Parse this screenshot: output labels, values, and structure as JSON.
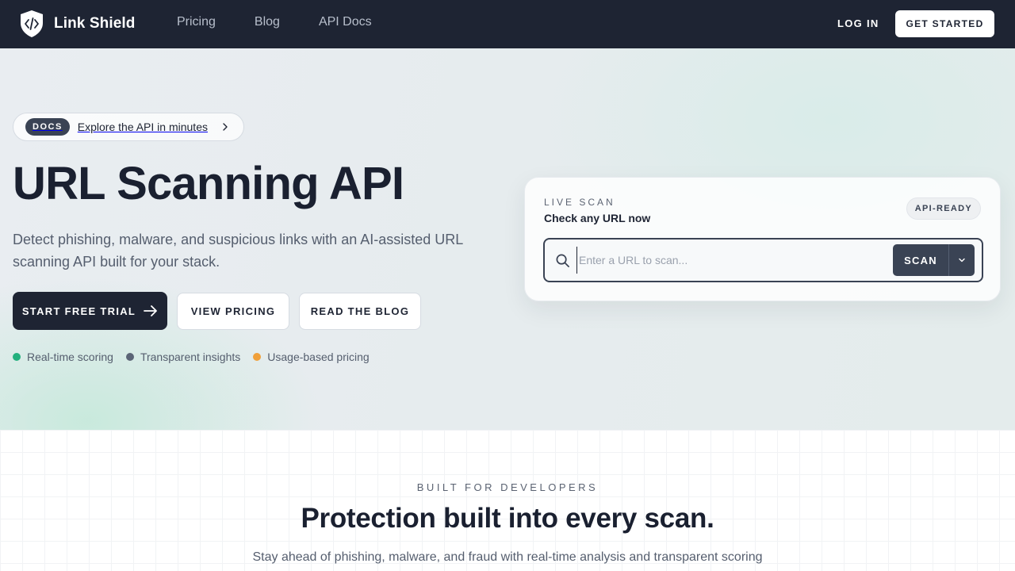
{
  "nav": {
    "brand": "Link Shield",
    "links": [
      "Pricing",
      "Blog",
      "API Docs"
    ],
    "login": "LOG IN",
    "get_started": "GET STARTED"
  },
  "hero": {
    "pill_tag": "DOCS",
    "pill_text": "Explore the API in minutes",
    "title": "URL Scanning API",
    "subtitle": "Detect phishing, malware, and suspicious links with an AI-assisted URL scanning API built for your stack.",
    "primary_cta": "START FREE TRIAL",
    "pricing_cta": "VIEW PRICING",
    "blog_cta": "READ THE BLOG",
    "features": [
      {
        "label": "Real-time scoring",
        "color": "#22b07d"
      },
      {
        "label": "Transparent insights",
        "color": "#5b6476"
      },
      {
        "label": "Usage-based pricing",
        "color": "#f0a03a"
      }
    ]
  },
  "scan_card": {
    "kicker": "LIVE SCAN",
    "title": "Check any URL now",
    "badge": "API-READY",
    "input_value": "",
    "input_placeholder": "Enter a URL to scan...",
    "scan_button": "SCAN"
  },
  "section": {
    "kicker": "BUILT FOR DEVELOPERS",
    "title": "Protection built into every scan.",
    "subtitle": "Stay ahead of phishing, malware, and fraud with real-time analysis and transparent scoring"
  },
  "colors": {
    "nav_bg": "#1e2433",
    "primary": "#1e2433",
    "scan_button": "#3a4354"
  },
  "icons": {
    "brand": "shield-code-icon",
    "pill": "chevron-right-icon",
    "cta": "arrow-right-icon",
    "search": "search-icon",
    "dropdown": "chevron-down-icon"
  }
}
